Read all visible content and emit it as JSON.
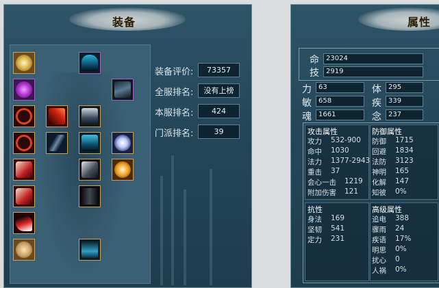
{
  "equipment": {
    "title": "装备",
    "ratings": [
      {
        "label": "装备评价:",
        "value": "73357"
      },
      {
        "label": "全服排名:",
        "value": "没有上榜"
      },
      {
        "label": "本服排名:",
        "value": "424"
      },
      {
        "label": "门派排名:",
        "value": "39"
      }
    ]
  },
  "attributes": {
    "title": "属性",
    "top": [
      {
        "label": "命",
        "value": "23024"
      },
      {
        "label": "技",
        "value": "2919"
      }
    ],
    "base": [
      {
        "label": "力",
        "value": "63"
      },
      {
        "label": "体",
        "value": "295"
      },
      {
        "label": "敏",
        "value": "658"
      },
      {
        "label": "疾",
        "value": "339"
      },
      {
        "label": "魂",
        "value": "1661"
      },
      {
        "label": "念",
        "value": "237"
      }
    ],
    "attack": {
      "title": "攻击属性",
      "rows": [
        {
          "name": "攻力",
          "value": "532-900"
        },
        {
          "name": "命中",
          "value": "1030"
        },
        {
          "name": "法力",
          "value": "1377-2943"
        },
        {
          "name": "重击",
          "value": "37"
        },
        {
          "name": "会心一击",
          "value": "1219"
        },
        {
          "name": "附加伤害",
          "value": "121"
        }
      ]
    },
    "defense": {
      "title": "防御属性",
      "rows": [
        {
          "name": "防御",
          "value": "1715"
        },
        {
          "name": "回避",
          "value": "1834"
        },
        {
          "name": "法防",
          "value": "3123"
        },
        {
          "name": "神明",
          "value": "165"
        },
        {
          "name": "化解",
          "value": "147"
        },
        {
          "name": "知彼",
          "value": "0%"
        }
      ]
    },
    "resist": {
      "title": "抗性",
      "rows": [
        {
          "name": "身法",
          "value": "169"
        },
        {
          "name": "坚韧",
          "value": "541"
        },
        {
          "name": "定力",
          "value": "231"
        }
      ]
    },
    "advanced": {
      "title": "高级属性",
      "rows": [
        {
          "name": "追电",
          "value": "388"
        },
        {
          "name": "骤雨",
          "value": "24"
        },
        {
          "name": "疾语",
          "value": "17%"
        },
        {
          "name": "明思",
          "value": "0%"
        },
        {
          "name": "扰心",
          "value": "0"
        },
        {
          "name": "人祸",
          "value": "0%"
        }
      ]
    }
  },
  "colors": {
    "panel": "#244659",
    "slot_border_gold": "#c9a05a",
    "slot_border_purple": "#a060c0",
    "title_text": "#2b1b00"
  }
}
